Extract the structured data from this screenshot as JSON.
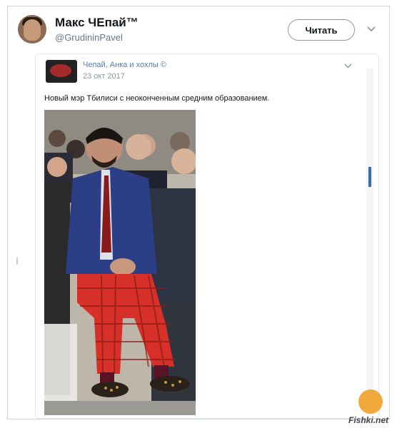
{
  "header": {
    "name": "Макс ЧЕпай™",
    "handle": "@GrudininPavel",
    "follow_label": "Читать"
  },
  "quoted": {
    "author": "Чепай, Анка и хохлы ©",
    "date": "23 окт 2017",
    "text": "Новый мэр Тбилиси с неоконченным средним образованием."
  },
  "watermark": {
    "site": "Fishki.net"
  },
  "colors": {
    "link_blue": "#5a7da8",
    "muted": "#657786",
    "scroll_thumb": "#3b6ea8"
  }
}
